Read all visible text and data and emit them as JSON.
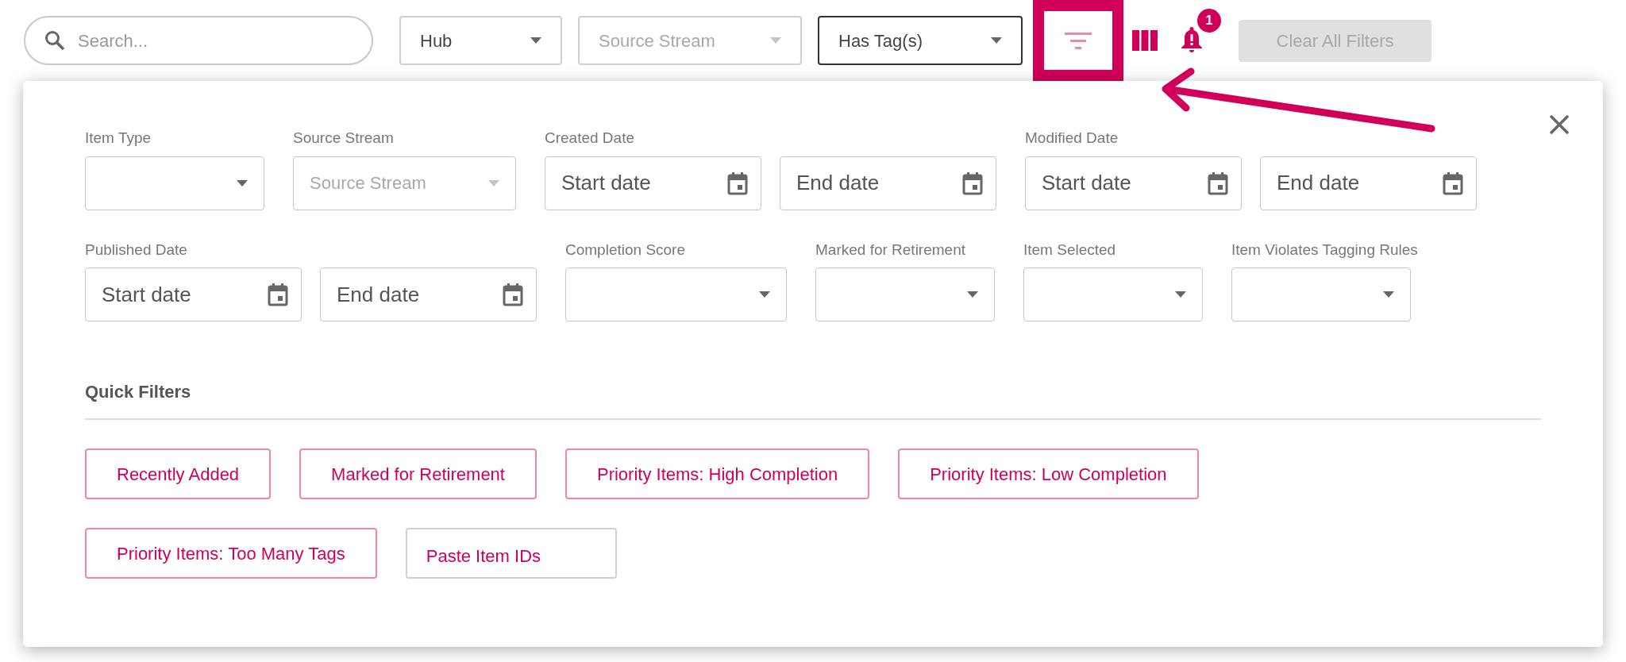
{
  "toolbar": {
    "search": {
      "placeholder": "Search..."
    },
    "dropdowns": [
      {
        "value": "Hub",
        "disabled": false,
        "focused": false
      },
      {
        "placeholder": "Source Stream",
        "disabled": true,
        "focused": false
      },
      {
        "value": "Has Tag(s)",
        "disabled": false,
        "focused": true
      }
    ],
    "filter_button": {
      "highlighted": true
    },
    "notifications": {
      "badge": "1"
    },
    "clear_button": {
      "label": "Clear All Filters",
      "disabled": true
    }
  },
  "filter_panel": {
    "fields": [
      {
        "label": "Item Type",
        "kind": "select",
        "disabled": false
      },
      {
        "label": "Source Stream",
        "kind": "select",
        "placeholder": "Source Stream",
        "disabled": true
      },
      {
        "label": "Created Date",
        "kind": "daterange",
        "start": "Start date",
        "end": "End date"
      },
      {
        "label": "Modified Date",
        "kind": "daterange",
        "start": "Start date",
        "end": "End date"
      },
      {
        "label": "Published Date",
        "kind": "daterange",
        "start": "Start date",
        "end": "End date"
      },
      {
        "label": "Completion Score",
        "kind": "select",
        "disabled": false
      },
      {
        "label": "Marked for Retirement",
        "kind": "select",
        "disabled": false
      },
      {
        "label": "Item Selected",
        "kind": "select",
        "disabled": false
      },
      {
        "label": "Item Violates Tagging Rules",
        "kind": "select",
        "disabled": false
      }
    ],
    "quick_filters_title": "Quick Filters",
    "quick_filters": [
      {
        "label": "Recently Added",
        "kind": "preset"
      },
      {
        "label": "Marked for Retirement",
        "kind": "preset"
      },
      {
        "label": "Priority Items: High Completion",
        "kind": "preset"
      },
      {
        "label": "Priority Items: Low Completion",
        "kind": "preset"
      },
      {
        "label": "Priority Items: Too Many Tags",
        "kind": "preset"
      },
      {
        "label": "Paste Item IDs",
        "kind": "paste"
      }
    ]
  }
}
